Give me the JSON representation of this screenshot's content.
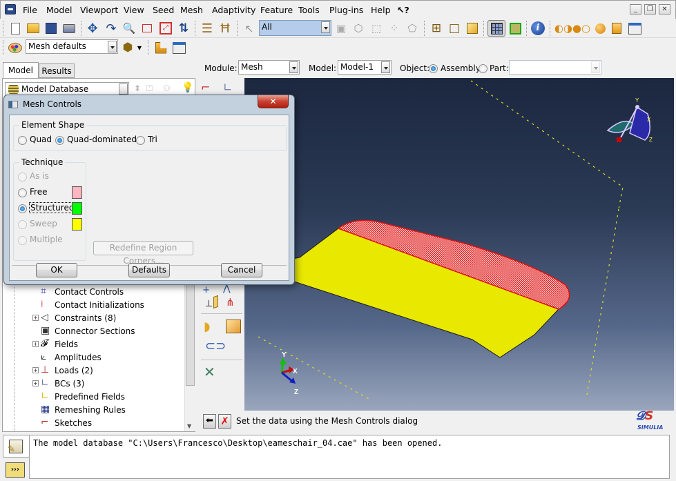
{
  "menubar": {
    "items": [
      "File",
      "Model",
      "Viewport",
      "View",
      "Seed",
      "Mesh",
      "Adaptivity",
      "Feature",
      "Tools",
      "Plug-ins",
      "Help"
    ],
    "whats_this": "?"
  },
  "window_controls": {
    "minimize": "_",
    "restore": "❐",
    "close": "✕"
  },
  "toolbar": {
    "selection_filter": "All",
    "mesh_defaults": "Mesh defaults"
  },
  "tabs": {
    "model": "Model",
    "results": "Results"
  },
  "tree": {
    "root": "Model Database",
    "items": [
      {
        "label": "Contact Controls",
        "expandable": false
      },
      {
        "label": "Contact Initializations",
        "expandable": false
      },
      {
        "label": "Constraints (8)",
        "expandable": true
      },
      {
        "label": "Connector Sections",
        "expandable": false
      },
      {
        "label": "Fields",
        "expandable": true
      },
      {
        "label": "Amplitudes",
        "expandable": false
      },
      {
        "label": "Loads (2)",
        "expandable": true
      },
      {
        "label": "BCs (3)",
        "expandable": true
      },
      {
        "label": "Predefined Fields",
        "expandable": false
      },
      {
        "label": "Remeshing Rules",
        "expandable": false
      },
      {
        "label": "Sketches",
        "expandable": false
      }
    ]
  },
  "context_bar": {
    "module_label": "Module:",
    "module_value": "Mesh",
    "model_label": "Model:",
    "model_value": "Model-1",
    "object_label": "Object:",
    "assembly_label": "Assembly",
    "part_label": "Part:",
    "part_value": "",
    "object_selected": "Assembly"
  },
  "dialog": {
    "title": "Mesh Controls",
    "element_shape": {
      "title": "Element Shape",
      "options": [
        "Quad",
        "Quad-dominated",
        "Tri"
      ],
      "selected": "Quad-dominated"
    },
    "technique": {
      "title": "Technique",
      "options": [
        {
          "label": "As is",
          "enabled": false,
          "color": null
        },
        {
          "label": "Free",
          "enabled": true,
          "color": "#ffb6c1"
        },
        {
          "label": "Structured",
          "enabled": true,
          "color": "#00ff00"
        },
        {
          "label": "Sweep",
          "enabled": false,
          "color": "#ffff00"
        },
        {
          "label": "Multiple",
          "enabled": false,
          "color": null
        }
      ],
      "selected": "Structured"
    },
    "redefine_button": "Redefine Region Corners...",
    "ok_button": "OK",
    "defaults_button": "Defaults",
    "cancel_button": "Cancel"
  },
  "viewport": {
    "triad_labels": {
      "x": "X",
      "y": "Y",
      "z": "Z"
    },
    "colors": {
      "background_top": "#1c2740",
      "background_bottom": "#9aa6bd",
      "part_fill": "#e8e800",
      "hatch": "#e02020",
      "bbox_line": "#e0e020"
    }
  },
  "prompt": {
    "text": "Set the data using the Mesh Controls dialog"
  },
  "message_area": {
    "text": "The model database \"C:\\Users\\Francesco\\Desktop\\eameschair_04.cae\" has been opened."
  },
  "brand": {
    "logo_text": "SIMULIA"
  }
}
